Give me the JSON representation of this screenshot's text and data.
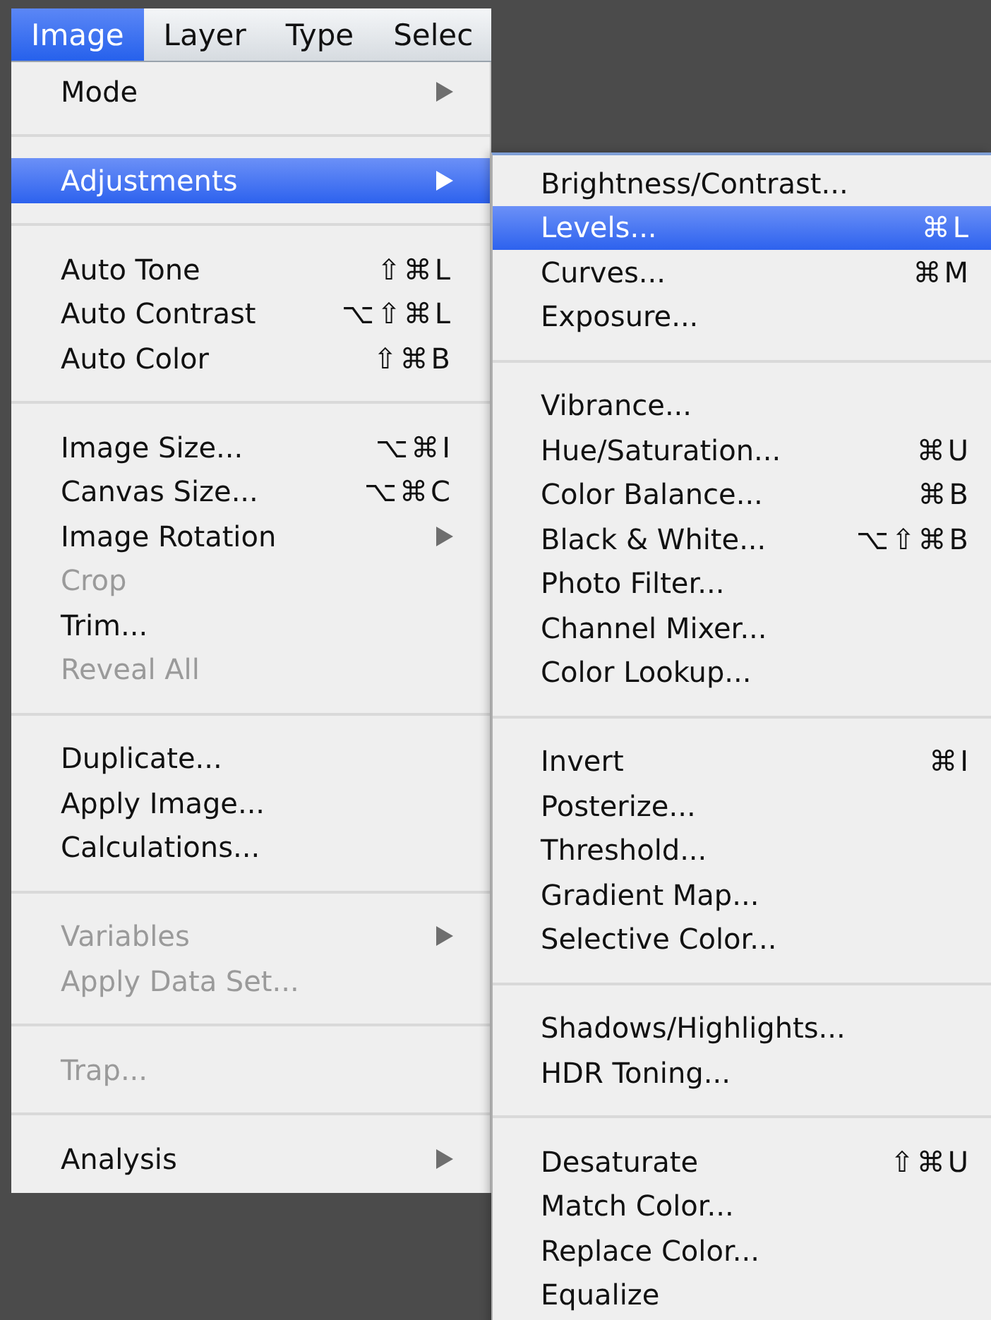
{
  "menubar": [
    {
      "label": "Image",
      "selected": true
    },
    {
      "label": "Layer",
      "selected": false
    },
    {
      "label": "Type",
      "selected": false
    },
    {
      "label": "Selec",
      "selected": false
    }
  ],
  "menu": {
    "items": [
      {
        "kind": "item",
        "label": "Mode",
        "has_submenu": true,
        "disabled": false,
        "selected": false
      },
      {
        "kind": "separator"
      },
      {
        "kind": "item",
        "label": "Adjustments",
        "has_submenu": true,
        "disabled": false,
        "selected": true
      },
      {
        "kind": "separator"
      },
      {
        "kind": "item",
        "label": "Auto Tone",
        "shortcut": "⇧⌘L",
        "has_submenu": false,
        "disabled": false,
        "selected": false
      },
      {
        "kind": "item",
        "label": "Auto Contrast",
        "shortcut": "⌥⇧⌘L",
        "has_submenu": false,
        "disabled": false,
        "selected": false
      },
      {
        "kind": "item",
        "label": "Auto Color",
        "shortcut": "⇧⌘B",
        "has_submenu": false,
        "disabled": false,
        "selected": false
      },
      {
        "kind": "separator"
      },
      {
        "kind": "item",
        "label": "Image Size...",
        "shortcut": "⌥⌘I",
        "has_submenu": false,
        "disabled": false,
        "selected": false
      },
      {
        "kind": "item",
        "label": "Canvas Size...",
        "shortcut": "⌥⌘C",
        "has_submenu": false,
        "disabled": false,
        "selected": false
      },
      {
        "kind": "item",
        "label": "Image Rotation",
        "has_submenu": true,
        "disabled": false,
        "selected": false
      },
      {
        "kind": "item",
        "label": "Crop",
        "has_submenu": false,
        "disabled": true,
        "selected": false
      },
      {
        "kind": "item",
        "label": "Trim...",
        "has_submenu": false,
        "disabled": false,
        "selected": false
      },
      {
        "kind": "item",
        "label": "Reveal All",
        "has_submenu": false,
        "disabled": true,
        "selected": false
      },
      {
        "kind": "separator"
      },
      {
        "kind": "item",
        "label": "Duplicate...",
        "has_submenu": false,
        "disabled": false,
        "selected": false
      },
      {
        "kind": "item",
        "label": "Apply Image...",
        "has_submenu": false,
        "disabled": false,
        "selected": false
      },
      {
        "kind": "item",
        "label": "Calculations...",
        "has_submenu": false,
        "disabled": false,
        "selected": false
      },
      {
        "kind": "separator"
      },
      {
        "kind": "item",
        "label": "Variables",
        "has_submenu": true,
        "disabled": true,
        "selected": false
      },
      {
        "kind": "item",
        "label": "Apply Data Set...",
        "has_submenu": false,
        "disabled": true,
        "selected": false
      },
      {
        "kind": "separator"
      },
      {
        "kind": "item",
        "label": "Trap...",
        "has_submenu": false,
        "disabled": true,
        "selected": false
      },
      {
        "kind": "separator"
      },
      {
        "kind": "item",
        "label": "Analysis",
        "has_submenu": true,
        "disabled": false,
        "selected": false
      }
    ]
  },
  "submenu": {
    "items": [
      {
        "kind": "item",
        "label": "Brightness/Contrast...",
        "selected": false
      },
      {
        "kind": "item",
        "label": "Levels...",
        "shortcut": "⌘L",
        "selected": true
      },
      {
        "kind": "item",
        "label": "Curves...",
        "shortcut": "⌘M",
        "selected": false
      },
      {
        "kind": "item",
        "label": "Exposure...",
        "selected": false
      },
      {
        "kind": "separator"
      },
      {
        "kind": "item",
        "label": "Vibrance...",
        "selected": false
      },
      {
        "kind": "item",
        "label": "Hue/Saturation...",
        "shortcut": "⌘U",
        "selected": false
      },
      {
        "kind": "item",
        "label": "Color Balance...",
        "shortcut": "⌘B",
        "selected": false
      },
      {
        "kind": "item",
        "label": "Black & White...",
        "shortcut": "⌥⇧⌘B",
        "selected": false
      },
      {
        "kind": "item",
        "label": "Photo Filter...",
        "selected": false
      },
      {
        "kind": "item",
        "label": "Channel Mixer...",
        "selected": false
      },
      {
        "kind": "item",
        "label": "Color Lookup...",
        "selected": false
      },
      {
        "kind": "separator"
      },
      {
        "kind": "item",
        "label": "Invert",
        "shortcut": "⌘I",
        "selected": false
      },
      {
        "kind": "item",
        "label": "Posterize...",
        "selected": false
      },
      {
        "kind": "item",
        "label": "Threshold...",
        "selected": false
      },
      {
        "kind": "item",
        "label": "Gradient Map...",
        "selected": false
      },
      {
        "kind": "item",
        "label": "Selective Color...",
        "selected": false
      },
      {
        "kind": "separator"
      },
      {
        "kind": "item",
        "label": "Shadows/Highlights...",
        "selected": false
      },
      {
        "kind": "item",
        "label": "HDR Toning...",
        "selected": false
      },
      {
        "kind": "separator"
      },
      {
        "kind": "item",
        "label": "Desaturate",
        "shortcut": "⇧⌘U",
        "selected": false
      },
      {
        "kind": "item",
        "label": "Match Color...",
        "selected": false
      },
      {
        "kind": "item",
        "label": "Replace Color...",
        "selected": false
      },
      {
        "kind": "item",
        "label": "Equalize",
        "selected": false
      }
    ]
  }
}
